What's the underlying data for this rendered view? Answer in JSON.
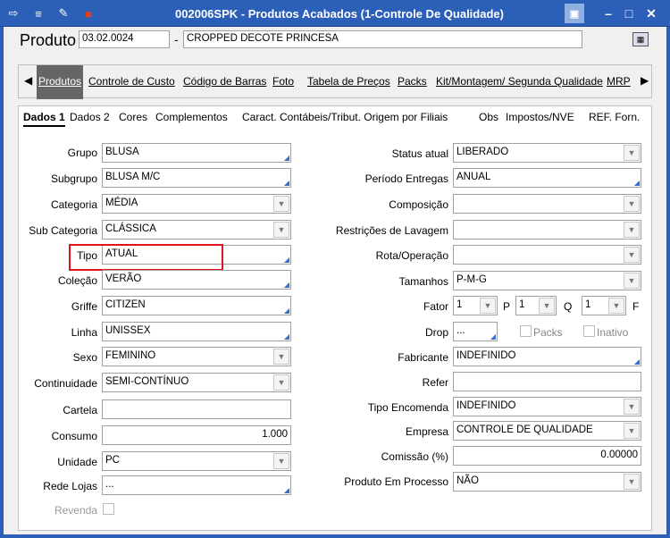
{
  "window": {
    "title": "002006SPK - Produtos Acabados (1-Controle De Qualidade)"
  },
  "header": {
    "label": "Produto",
    "code": "03.02.0024",
    "separator": "-",
    "description": "CROPPED DECOTE PRINCESA"
  },
  "tabs": [
    {
      "label": "Produtos"
    },
    {
      "label": "Controle de Custo"
    },
    {
      "label": "Código de Barras"
    },
    {
      "label": "Foto"
    },
    {
      "label": "Tabela de Preços"
    },
    {
      "label": "Packs"
    },
    {
      "label": "Kit/Montagem/ Segunda Qualidade"
    },
    {
      "label": "MRP"
    }
  ],
  "subtabs": [
    {
      "label": "Dados 1"
    },
    {
      "label": "Dados 2"
    },
    {
      "label": "Cores"
    },
    {
      "label": "Complementos"
    },
    {
      "label": "Caract. Contábeis/Tribut. Origem por Filiais"
    },
    {
      "label": "Obs"
    },
    {
      "label": "Impostos/NVE"
    },
    {
      "label": "REF. Forn."
    }
  ],
  "left": {
    "grupo": {
      "label": "Grupo",
      "value": "BLUSA"
    },
    "subgrupo": {
      "label": "Subgrupo",
      "value": "BLUSA M/C"
    },
    "categoria": {
      "label": "Categoria",
      "value": "MÉDIA"
    },
    "subcategoria": {
      "label": "Sub Categoria",
      "value": "CLÁSSICA"
    },
    "tipo": {
      "label": "Tipo",
      "value": "ATUAL"
    },
    "colecao": {
      "label": "Coleção",
      "value": "VERÃO"
    },
    "griffe": {
      "label": "Griffe",
      "value": "CITIZEN"
    },
    "linha": {
      "label": "Linha",
      "value": "UNISSEX"
    },
    "sexo": {
      "label": "Sexo",
      "value": "FEMININO"
    },
    "continuidade": {
      "label": "Continuidade",
      "value": "SEMI-CONTÍNUO"
    },
    "cartela": {
      "label": "Cartela",
      "value": ""
    },
    "consumo": {
      "label": "Consumo",
      "value": "1.000"
    },
    "unidade": {
      "label": "Unidade",
      "value": "PC"
    },
    "redelojas": {
      "label": "Rede Lojas",
      "value": "..."
    },
    "revenda": {
      "label": "Revenda"
    }
  },
  "right": {
    "status": {
      "label": "Status atual",
      "value": "LIBERADO"
    },
    "periodo": {
      "label": "Período Entregas",
      "value": "ANUAL"
    },
    "composicao": {
      "label": "Composição",
      "value": ""
    },
    "restricoes": {
      "label": "Restrições de Lavagem",
      "value": ""
    },
    "rota": {
      "label": "Rota/Operação",
      "value": ""
    },
    "tamanhos": {
      "label": "Tamanhos",
      "value": "P-M-G"
    },
    "fator": {
      "label": "Fator",
      "value1": "1",
      "p_label": "P",
      "value2": "1",
      "q_label": "Q",
      "value3": "1",
      "f_label": "F"
    },
    "drop": {
      "label": "Drop",
      "value": "...",
      "packs": "Packs",
      "inativo": "Inativo"
    },
    "fabricante": {
      "label": "Fabricante",
      "value": "INDEFINIDO"
    },
    "refer": {
      "label": "Refer",
      "value": ""
    },
    "tipoencomenda": {
      "label": "Tipo Encomenda",
      "value": "INDEFINIDO"
    },
    "empresa": {
      "label": "Empresa",
      "value": "CONTROLE DE QUALIDADE"
    },
    "comissao": {
      "label": "Comissão (%)",
      "value": "0.00000"
    },
    "processo": {
      "label": "Produto Em Processo",
      "value": "NÃO"
    }
  }
}
